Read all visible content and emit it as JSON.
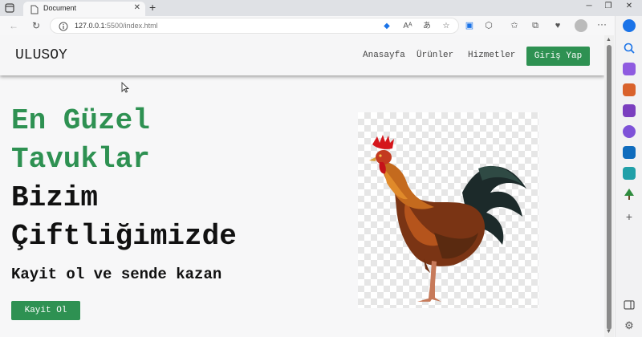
{
  "browser": {
    "tab_title": "Document",
    "url_host": "127.0.0.1",
    "url_rest": ":5500/index.html"
  },
  "site": {
    "brand": "ULUSOY",
    "nav": [
      "Anasayfa",
      "Ürünler",
      "Hizmetler"
    ],
    "login_label": "Giriş Yap"
  },
  "hero": {
    "line1": "En Güzel",
    "line2": "Tavuklar",
    "line3": "Bizim",
    "line4": "Çiftliğimizde",
    "subtitle": "Kayit ol ve sende kazan",
    "button": "Kayit Ol"
  },
  "colors": {
    "accent": "#2e9152"
  },
  "icons": {
    "hero_image": "rooster-image"
  }
}
